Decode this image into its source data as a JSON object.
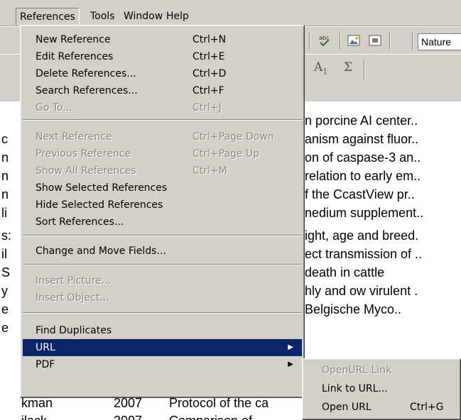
{
  "menubar": {
    "items": [
      {
        "label": "References",
        "open": true
      },
      {
        "label": "Tools"
      },
      {
        "label": "Window"
      },
      {
        "label": "Help"
      }
    ]
  },
  "toolbar": {
    "style_value": "Nature",
    "spell_icon_text": "abc",
    "format_a": "A",
    "format_a_sub": "1",
    "format_sigma": "Σ"
  },
  "references_menu": {
    "items": [
      {
        "label": "New Reference",
        "shortcut": "Ctrl+N",
        "enabled": true
      },
      {
        "label": "Edit References",
        "shortcut": "Ctrl+E",
        "enabled": true
      },
      {
        "label": "Delete References...",
        "shortcut": "Ctrl+D",
        "enabled": true
      },
      {
        "label": "Search References...",
        "shortcut": "Ctrl+F",
        "enabled": true
      },
      {
        "label": "Go To...",
        "shortcut": "Ctrl+J",
        "enabled": false
      },
      {
        "label": "Next Reference",
        "shortcut": "Ctrl+Page Down",
        "enabled": false
      },
      {
        "label": "Previous Reference",
        "shortcut": "Ctrl+Page Up",
        "enabled": false
      },
      {
        "label": "Show All References",
        "shortcut": "Ctrl+M",
        "enabled": false
      },
      {
        "label": "Show Selected References",
        "shortcut": "",
        "enabled": true
      },
      {
        "label": "Hide Selected References",
        "shortcut": "",
        "enabled": true
      },
      {
        "label": "Sort References...",
        "shortcut": "",
        "enabled": true
      },
      {
        "label": "Change and Move Fields...",
        "shortcut": "",
        "enabled": true
      },
      {
        "label": "Insert Picture...",
        "shortcut": "",
        "enabled": false
      },
      {
        "label": "Insert Object...",
        "shortcut": "",
        "enabled": false
      },
      {
        "label": "Find Duplicates",
        "shortcut": "",
        "enabled": true
      },
      {
        "label": "URL",
        "shortcut": "",
        "enabled": true,
        "highlighted": true,
        "submenu": true
      },
      {
        "label": "PDF",
        "shortcut": "",
        "enabled": true,
        "submenu": true
      }
    ]
  },
  "url_submenu": {
    "items": [
      {
        "label": "OpenURL Link",
        "shortcut": "",
        "enabled": false
      },
      {
        "label": "Link to URL...",
        "shortcut": "",
        "enabled": true
      },
      {
        "label": "Open URL",
        "shortcut": "Ctrl+G",
        "enabled": true
      }
    ]
  },
  "reference_list": {
    "rows": [
      {
        "author": "",
        "year": "",
        "title": "n porcine AI center.."
      },
      {
        "author": "c",
        "year": "",
        "title": "anism against fluor.."
      },
      {
        "author": "n",
        "year": "",
        "title": "on of caspase-3 an.."
      },
      {
        "author": "n",
        "year": "",
        "title": "relation to early em.."
      },
      {
        "author": "n",
        "year": "",
        "title": "f the CcastView pr.."
      },
      {
        "author": "li",
        "year": "",
        "title": "nedium supplement.."
      },
      {
        "author": "s:",
        "year": "",
        "title": "ight, age and breed."
      },
      {
        "author": "il",
        "year": "",
        "title": "ect transmission of .."
      },
      {
        "author": "S",
        "year": "",
        "title": "death in cattle"
      },
      {
        "author": "y",
        "year": "",
        "title": "hly and ow virulent ."
      },
      {
        "author": "e",
        "year": "",
        "title": "Belgische Myco.."
      },
      {
        "author": "e",
        "year": "",
        "title": ""
      },
      {
        "author": "kman",
        "year": "2007",
        "title": "Protocol of the ca"
      },
      {
        "author": "ilack",
        "year": "2007",
        "title": "Comparison of"
      }
    ]
  }
}
